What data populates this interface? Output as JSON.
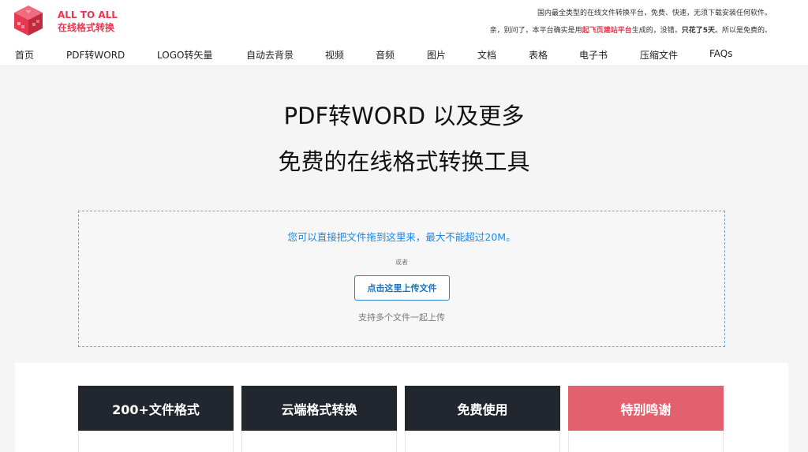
{
  "brand": {
    "line1": "ALL TO ALL",
    "line2": "在线格式转换",
    "logo_icon": "cube-logo-icon",
    "color": "#e8384f"
  },
  "notice": {
    "line1": "国内最全类型的在线文件转换平台，免费、快速，无须下载安装任何软件。",
    "line2_pre": "亲，别问了，本平台确实是用",
    "line2_link": "起飞页建站平台",
    "line2_mid": "生成的，没错，",
    "line2_bold": "只花了5天",
    "line2_post": "。所以是免费的。"
  },
  "nav": {
    "items": [
      "首页",
      "PDF转WORD",
      "LOGO转矢量",
      "自动去背景",
      "视频",
      "音频",
      "图片",
      "文档",
      "表格",
      "电子书",
      "压缩文件",
      "FAQs"
    ]
  },
  "hero": {
    "title1": "PDF转WORD 以及更多",
    "title2": "免费的在线格式转换工具"
  },
  "dropzone": {
    "main_text": "您可以直接把文件拖到这里来，最大不能超过20M。",
    "or_text": "或者",
    "button_label": "点击这里上传文件",
    "multi_text": "支持多个文件一起上传"
  },
  "features": {
    "cards": [
      {
        "title": "200+文件格式",
        "color": "#22262e"
      },
      {
        "title": "云端格式转换",
        "color": "#22262e"
      },
      {
        "title": "免费使用",
        "color": "#22262e"
      },
      {
        "title": "特别鸣谢",
        "color": "#e3606f"
      }
    ]
  }
}
